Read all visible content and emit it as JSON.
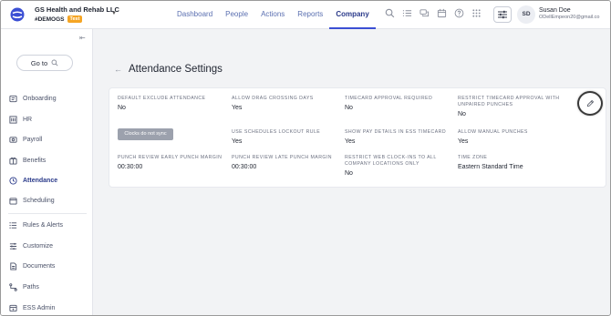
{
  "header": {
    "company_name": "GS Health and Rehab LLC",
    "company_code": "#DEMOGS",
    "env_badge": "Test",
    "nav": [
      {
        "label": "Dashboard"
      },
      {
        "label": "People"
      },
      {
        "label": "Actions"
      },
      {
        "label": "Reports"
      },
      {
        "label": "Company"
      }
    ],
    "active_nav": "Company",
    "user": {
      "initials": "SD",
      "name": "Susan Doe",
      "email": "ODellEmpeon20@gmail.co"
    }
  },
  "sidebar": {
    "goto_label": "Go to",
    "items": [
      {
        "label": "Onboarding",
        "icon": "onboarding-icon"
      },
      {
        "label": "HR",
        "icon": "hr-icon"
      },
      {
        "label": "Payroll",
        "icon": "payroll-icon"
      },
      {
        "label": "Benefits",
        "icon": "benefits-icon"
      },
      {
        "label": "Attendance",
        "icon": "clock-icon"
      },
      {
        "label": "Scheduling",
        "icon": "calendar-icon"
      },
      {
        "label": "Rules & Alerts",
        "icon": "rules-icon"
      },
      {
        "label": "Customize",
        "icon": "sliders-icon"
      },
      {
        "label": "Documents",
        "icon": "document-icon"
      },
      {
        "label": "Paths",
        "icon": "paths-icon"
      },
      {
        "label": "ESS Admin",
        "icon": "ess-admin-icon"
      }
    ],
    "active_item": "Attendance"
  },
  "main": {
    "title": "Attendance Settings",
    "sync_button": "Clocks do not sync",
    "fields": [
      {
        "label": "Default Exclude Attendance",
        "value": "No"
      },
      {
        "label": "Allow Drag Crossing Days",
        "value": "Yes"
      },
      {
        "label": "Timecard Approval Required",
        "value": "No"
      },
      {
        "label": "Restrict Timecard Approval With Unpaired Punches",
        "value": "No"
      },
      {
        "label": "Use Schedules Lockout Rule",
        "value": "Yes"
      },
      {
        "label": "Show Pay Details In ESS Timecard",
        "value": "Yes"
      },
      {
        "label": "Allow Manual Punches",
        "value": "Yes"
      },
      {
        "label": "Punch Review Early Punch Margin",
        "value": "00:30:00"
      },
      {
        "label": "Punch Review Late Punch Margin",
        "value": "00:30:00"
      },
      {
        "label": "Restrict Web Clock-Ins To All Company Locations Only",
        "value": "No"
      },
      {
        "label": "Time Zone",
        "value": "Eastern Standard Time"
      }
    ]
  },
  "colors": {
    "accent": "#3b4fd4",
    "nav_text": "#5a6fb0",
    "badge": "#f5a524",
    "sync_button": "#9ca1ad"
  }
}
